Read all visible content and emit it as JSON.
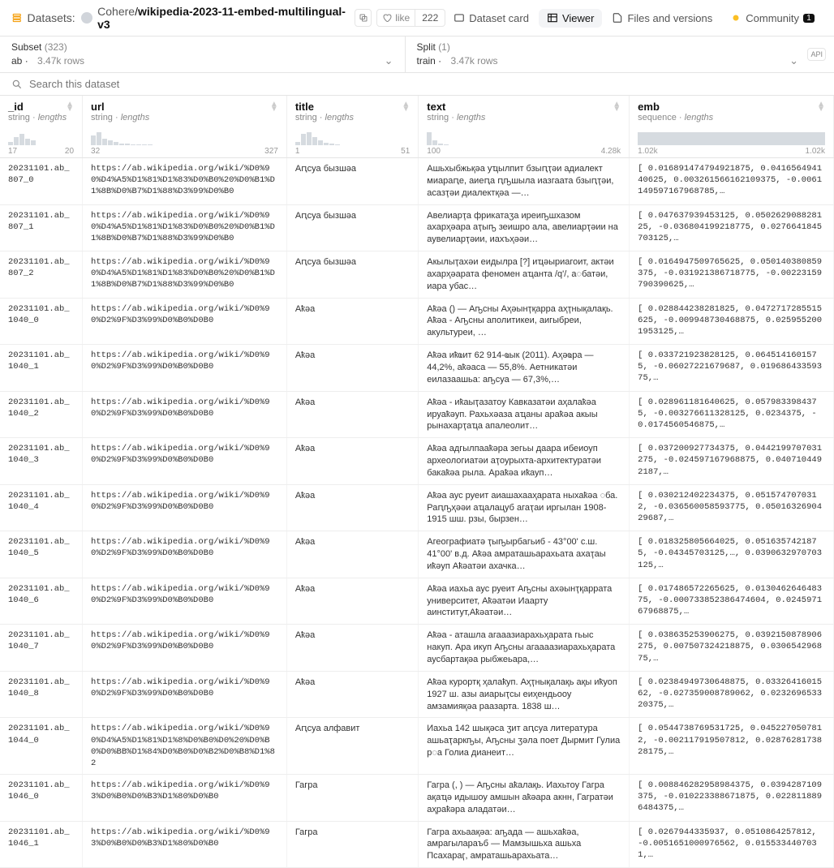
{
  "header": {
    "datasets_label": "Datasets:",
    "owner": "Cohere",
    "name": "wikipedia-2023-11-embed-multilingual-v3",
    "like_label": "like",
    "like_count": "222"
  },
  "tabs": {
    "card": "Dataset card",
    "viewer": "Viewer",
    "files": "Files and versions",
    "community": "Community",
    "community_count": "1"
  },
  "subset": {
    "label": "Subset",
    "count": "(323)",
    "value": "ab",
    "rows": "3.47k rows"
  },
  "split": {
    "label": "Split",
    "count": "(1)",
    "value": "train",
    "rows": "3.47k rows"
  },
  "search": {
    "placeholder": "Search this dataset"
  },
  "columns": [
    {
      "name": "_id",
      "type": "string",
      "lengths": true,
      "range": [
        "17",
        "20"
      ],
      "spark": [
        4,
        10,
        14,
        8,
        6
      ]
    },
    {
      "name": "url",
      "type": "string",
      "lengths": true,
      "range": [
        "32",
        "327"
      ],
      "spark": [
        12,
        16,
        8,
        6,
        4,
        2,
        2,
        1,
        1,
        1,
        1
      ]
    },
    {
      "name": "title",
      "type": "string",
      "lengths": true,
      "range": [
        "1",
        "51"
      ],
      "spark": [
        4,
        14,
        16,
        10,
        6,
        3,
        2,
        1
      ]
    },
    {
      "name": "text",
      "type": "string",
      "lengths": true,
      "range": [
        "100",
        "4.28k"
      ],
      "spark": [
        16,
        6,
        2,
        1
      ]
    },
    {
      "name": "emb",
      "type": "sequence",
      "lengths": true,
      "range": [
        "1.02k",
        "1.02k"
      ],
      "spark": [
        16
      ]
    }
  ],
  "rows": [
    {
      "id": "20231101.ab_807_0",
      "url": "https://ab.wikipedia.org/wiki/%D0%90%D4%A5%D1%81%D1%83%D0%B0%20%D0%B1%D1%8B%D0%B7%D1%88%D3%99%D0%B0",
      "title": "Аԥсуа бызшәа",
      "text": "Ашьхыбжьқәа уҵылпит бзыԥҭәи адиалект миараԥе, аиеԥа ԥҧшыла иазгаата бзыԥҭәи, асазҭәи диалектқәа —…",
      "emb": "[ 0.016891474794921875, 0.041656494140625, 0.003261566162109375, -0.0061149597167968785,…"
    },
    {
      "id": "20231101.ab_807_1",
      "url": "https://ab.wikipedia.org/wiki/%D0%90%D4%A5%D1%81%D1%83%D0%B0%20%D0%B1%D1%8B%D0%B7%D1%88%D3%99%D0%B0",
      "title": "Аԥсуа бызшәа",
      "text": "Авелиарҭа фрикатаӡа иреиҧшхазом ахарҳәара аҭыҧ зеишро ала, авелиарҭәии на аувелиарҭәии, иахъҳәәи…",
      "emb": "[ 0.047637939453125, 0.050262908828125, -0.036804199218775, 0.0276641845703125,…"
    },
    {
      "id": "20231101.ab_807_2",
      "url": "https://ab.wikipedia.org/wiki/%D0%90%D4%A5%D1%81%D1%83%D0%B0%20%D0%B1%D1%8B%D0%B7%D1%88%D3%99%D0%B0",
      "title": "Аԥсуа бызшәа",
      "text": "Акылыҭахәи еидылра [?] иҵәыриагоит, актәи ахарҳәарата феномен аҵанта /q'/, а◌батәи, иара убас…",
      "emb": "[ 0.0164947509765625, 0.050140380859375, -0.031921386718775, -0.00223159790390625,…"
    },
    {
      "id": "20231101.ab_1040_0",
      "url": "https://ab.wikipedia.org/wiki/%D0%90%D2%9F%D3%99%D0%B0%D0B0",
      "title": "Аҟәа",
      "text": "Аҟәа () — Аҧсны Аҳәынҭқарра аҳҭнықалақь. Аҟәа - Аҧсны аполитикеи, аигыбреи, акультуреи, …",
      "emb": "[ 0.028844238281825, 0.0472717285515625, -0.009948730468875, 0.0259552001953125,…"
    },
    {
      "id": "20231101.ab_1040_1",
      "url": "https://ab.wikipedia.org/wiki/%D0%90%D2%9F%D3%99%D0%B0%D0B0",
      "title": "Аҟәа",
      "text": "Аҟәа иҟҩит 62 914-ҩык (2011). Аҳәҩра — 44,2%, аҟәаса — 55,8%. Аетникатәи еилазаашьа: аҧсуа — 67,3%,…",
      "emb": "[ 0.033721923828125, 0.0645141601575, -0.06027221679687, 0.01968643359375,…"
    },
    {
      "id": "20231101.ab_1040_2",
      "url": "https://ab.wikipedia.org/wiki/%D0%90%D2%9F%D3%99%D0%B0%D0B0",
      "title": "Аҟәа",
      "text": "Аҟәа - иҟаыҭазатоу Кавказатәи  аҳалаҟәа ируаҟәуп. Рахьхәаза аҵаны араҟәа акыы рынахарҭаҵа апалеолит…",
      "emb": "[ 0.028961181640625, 0.0579833984375, -0.003276611328125, 0.0234375, -0.0174560546875,…"
    },
    {
      "id": "20231101.ab_1040_3",
      "url": "https://ab.wikipedia.org/wiki/%D0%90%D2%9F%D3%99%D0%B0%D0B0",
      "title": "Аҟәа",
      "text": "Аҟәа адгылпааҟәра зегьы даара ибеиоуп археологиатәи аҭоурыхта-архитектуратәи бакаҟәа рыла. Араҟәа иҟауп…",
      "emb": "[ 0.037200927734375, 0.0442199707031275, -0.024597167968875, 0.0407104492187,…"
    },
    {
      "id": "20231101.ab_1040_4",
      "url": "https://ab.wikipedia.org/wiki/%D0%90%D2%9F%D3%99%D0%B0%D0B0",
      "title": "Аҟәа",
      "text": "Аҟәа аус руеит аиашахааҳарата ныхаҟәа ◌ба. Раԥҧҳәәи аҵалацуб агаҭаи иргылан 1908-1915 шш. рзы, бырзен…",
      "emb": "[ 0.030212402234375, 0.0515747070312, -0.036560058593775, 0.0501632690429687,…"
    },
    {
      "id": "20231101.ab_1040_5",
      "url": "https://ab.wikipedia.org/wiki/%D0%90%D2%9F%D3%99%D0%B0%D0B0",
      "title": "Аҟәа",
      "text": "Агеографиатә ҭыҧырбагьиб - 43°00' с.ш. 41°00' в.д. Аҟәа амраташьарахьата ахаҭаы иҟәуп Аҟәатәи ахачка…",
      "emb": "[ 0.018325805664025, 0.0516357421875, -0.04345703125,…, 0.0390632970703125,…"
    },
    {
      "id": "20231101.ab_1040_6",
      "url": "https://ab.wikipedia.org/wiki/%D0%90%D2%9F%D3%99%D0%B0%D0B0",
      "title": "Аҟәа",
      "text": "Аҟәа иахьа аус руеит Аҧсны ахәынҭқаррата университет, Аҟәатәи Иаарту аинститут,Аҟәатәи…",
      "emb": "[ 0.017486572265625, 0.013046264648375, -0.000733852386474604, 0.024597167968875,…"
    },
    {
      "id": "20231101.ab_1040_7",
      "url": "https://ab.wikipedia.org/wiki/%D0%90%D2%9F%D3%99%D0%B0%D0B0",
      "title": "Аҟәа",
      "text": "Аҟәа - аташла агааазиарахьҳарата гьыс накуп. Ара икуп Аҧсны агаааазиарахьҳарата аусбартақәа рыбжеьара,…",
      "emb": "[ 0.038635253906275, 0.0392150878906275, 0.007507324218875, 0.030654296875,…"
    },
    {
      "id": "20231101.ab_1040_8",
      "url": "https://ab.wikipedia.org/wiki/%D0%90%D2%9F%D3%99%D0%B0%D0B0",
      "title": "Аҟәа",
      "text": "Аҟәа курортқ ҳалаҟуп. Аҳҭнықалақь ақы иҟуоп 1927 ш. азы аиарыҭсы еиҳендьооу амзамияқәа раазарта. 1838 ш…",
      "emb": "[ 0.02384949730648875, 0.0332641601562, -0.027359008789062, 0.023269653320375,…"
    },
    {
      "id": "20231101.ab_1044_0",
      "url": "https://ab.wikipedia.org/wiki/%D0%90%D4%A5%D1%81%D1%8%D0%B0%D0%20%D0%B0%D0%BB%D1%84%D0%B0%D0%B2%D0%B8%D1%82",
      "title": "Аԥсуа алфавит",
      "text": "Иахьа 142 шықәса ӡит аԥсуа литература ашьаҭаркҧы, Аҧсны ӡәла поет Дырмит Гулиа р◌а Голиa дианеит…",
      "emb": "[ 0.0544738769531725, 0.0452270507812, -0.002117919507812, 0.0287628173828175,…"
    },
    {
      "id": "20231101.ab_1046_0",
      "url": "https://ab.wikipedia.org/wiki/%D0%93%D0%B0%D0%B3%D1%80%D0%B0",
      "title": "Гагра",
      "text": "Гагра (, ) — Аҧсны аҟалақь. Иахьтоу Гагра ақаҵә идышоу амшын аҟәара акнн, Гагратәи аҳраҟәра аладатәи…",
      "emb": "[ 0.008846282958984375, 0.0394287109375, -0.010223388671875, 0.0228118896484375,…"
    },
    {
      "id": "20231101.ab_1046_1",
      "url": "https://ab.wikipedia.org/wiki/%D0%93%D0%B0%D0%B3%D1%80%D0%B0",
      "title": "Гагра",
      "text": "Гагра ахьаақәа: аҧада — ашьхаҟәа, амрагылараъб — Мамзышьха ашьха Псахараӷ, амраташьарахьата…",
      "emb": "[ 0.0267944335937, 0.0510864257812, -0.0051651000976562, 0.0155334407031,…"
    }
  ]
}
